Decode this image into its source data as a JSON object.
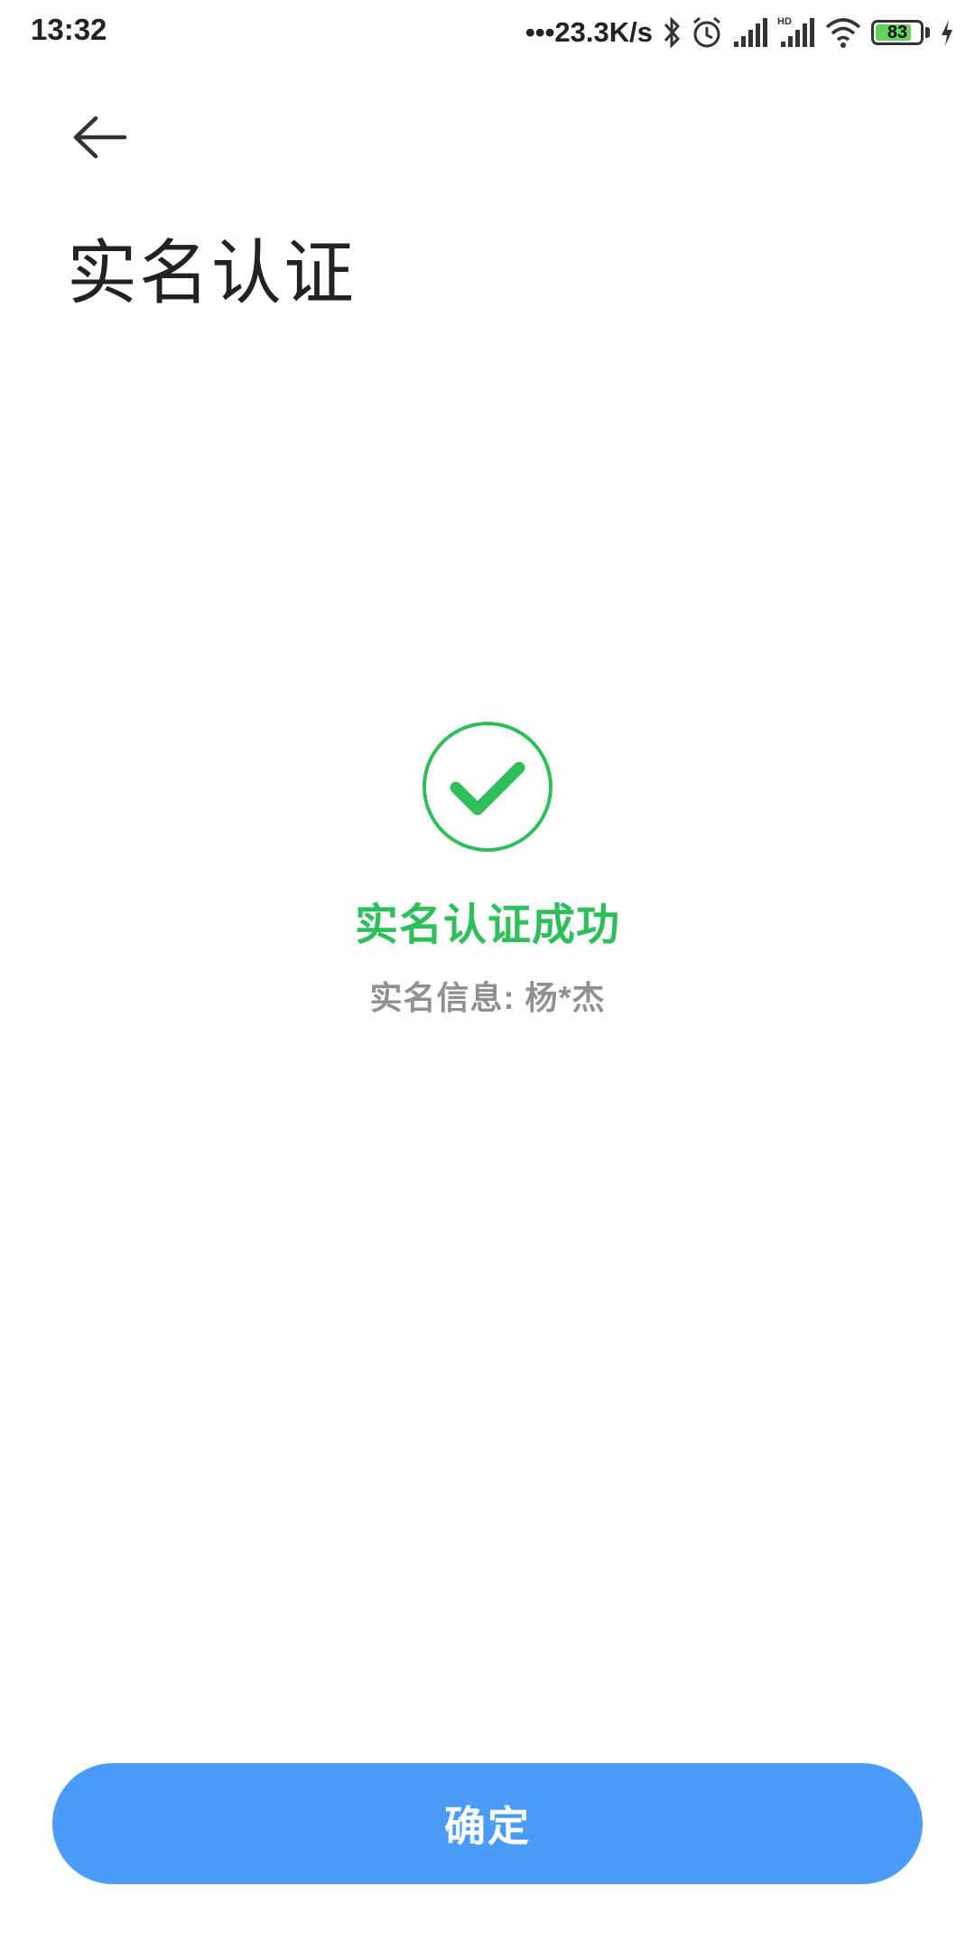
{
  "status_bar": {
    "time": "13:32",
    "net_speed": "•••23.3K/s",
    "battery_level": "83",
    "battery_fraction": 0.83,
    "icons": [
      "bluetooth-icon",
      "alarm-icon",
      "signal-icon",
      "hd-signal-icon",
      "wifi-icon",
      "battery-icon",
      "charging-icon"
    ]
  },
  "header": {
    "back_icon": "arrow-left-icon",
    "title": "实名认证"
  },
  "result": {
    "icon": "check-circle-icon",
    "title": "实名认证成功",
    "info": "实名信息: 杨*杰"
  },
  "footer": {
    "confirm_label": "确定"
  },
  "colors": {
    "success": "#2fbe5a",
    "primary": "#4a9cf6",
    "muted": "#909090"
  }
}
